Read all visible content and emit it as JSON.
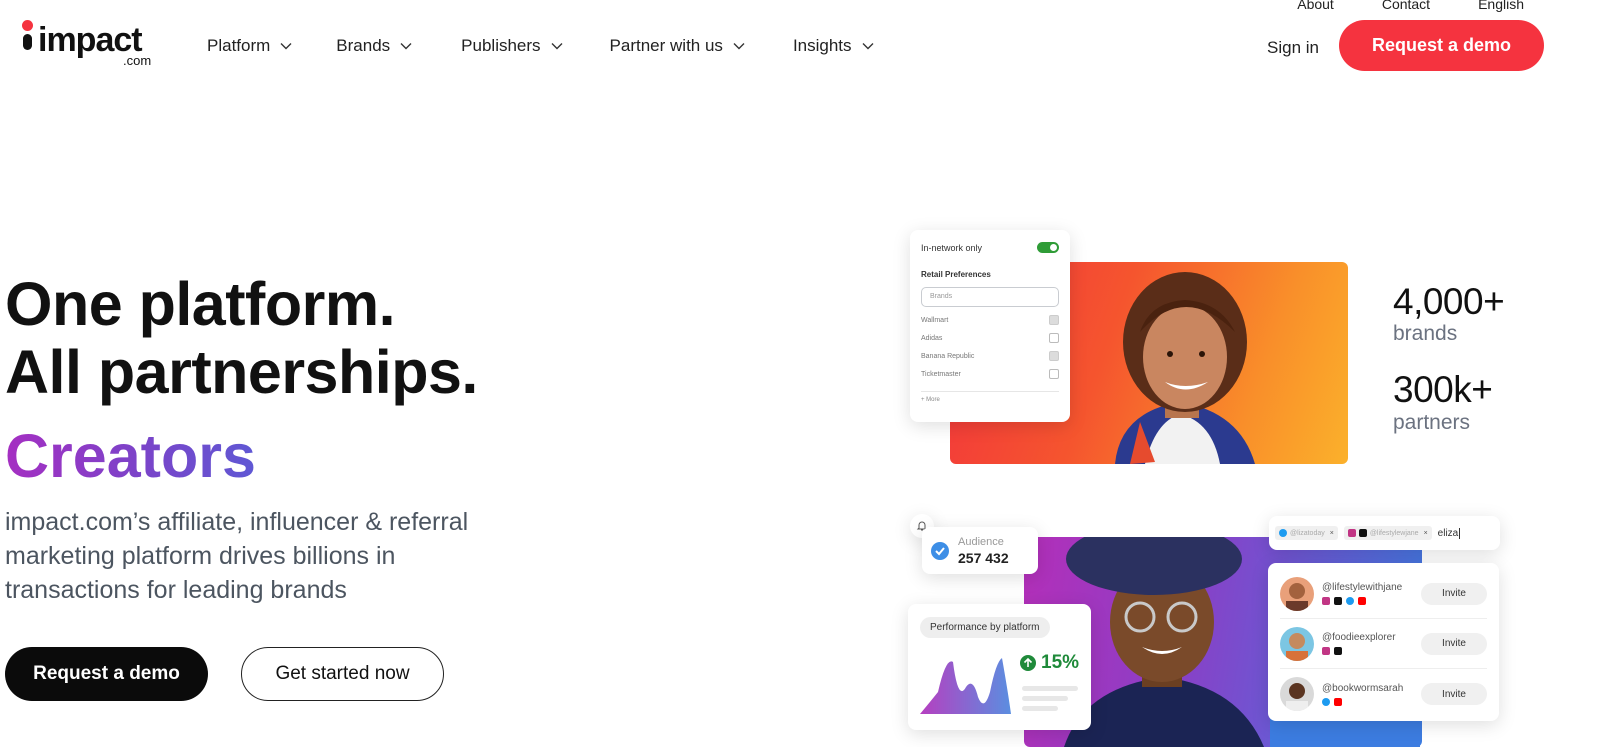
{
  "utility_nav": [
    "About",
    "Contact",
    "English"
  ],
  "logo": {
    "word": "impact",
    "suffix": ".com"
  },
  "nav": [
    {
      "label": "Platform"
    },
    {
      "label": "Brands"
    },
    {
      "label": "Publishers"
    },
    {
      "label": "Partner with us"
    },
    {
      "label": "Insights"
    }
  ],
  "header": {
    "sign_in": "Sign in",
    "cta": "Request a demo"
  },
  "hero": {
    "line1": "One platform.",
    "line2": "All partnerships.",
    "highlight": "Creators",
    "subtitle": "impact.com’s affiliate, influencer & referral marketing platform drives billions in transactions for leading brands",
    "primary_button": "Request a demo",
    "secondary_button": "Get started now"
  },
  "stats": [
    {
      "value": "4,000+",
      "label": "brands"
    },
    {
      "value": "300k+",
      "label": "partners"
    }
  ],
  "pref_card": {
    "toggle_label": "In-network only",
    "heading": "Retail Preferences",
    "search_placeholder": "Brands",
    "options": [
      {
        "name": "Wallmart",
        "checked": true
      },
      {
        "name": "Adidas",
        "checked": false
      },
      {
        "name": "Banana Republic",
        "checked": true
      },
      {
        "name": "Ticketmaster",
        "checked": false
      }
    ],
    "more": "+ More"
  },
  "audience": {
    "label": "Audience",
    "value": "257 432"
  },
  "performance": {
    "pill": "Performance by platform",
    "percent": "15%"
  },
  "tags": {
    "handles": [
      "@lizatoday",
      "@lifestylewjane"
    ],
    "typed": "eliza"
  },
  "influencers": [
    {
      "handle": "@lifestylewithjane",
      "button": "Invite"
    },
    {
      "handle": "@foodieexplorer",
      "button": "Invite"
    },
    {
      "handle": "@bookwormsarah",
      "button": "Invite"
    }
  ],
  "colors": {
    "brand_red": "#f5333f",
    "gradient_purple": "#a52fc2",
    "gradient_blue": "#5f58d4",
    "success_green": "#1f8a3a"
  }
}
